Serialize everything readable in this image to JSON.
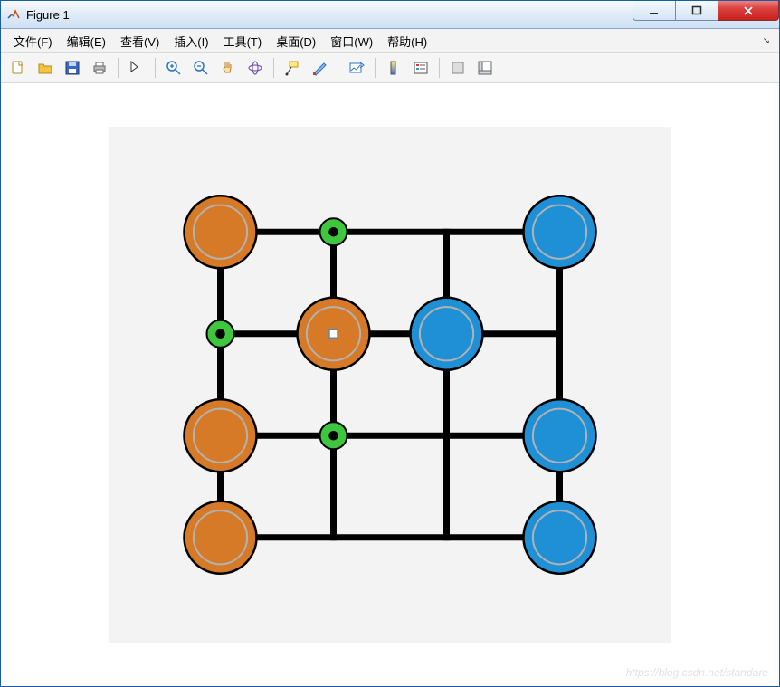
{
  "window": {
    "title": "Figure 1"
  },
  "menus": {
    "file": "文件(F)",
    "edit": "编辑(E)",
    "view": "查看(V)",
    "insert": "插入(I)",
    "tools": "工具(T)",
    "desktop": "桌面(D)",
    "window": "窗口(W)",
    "help": "帮助(H)"
  },
  "watermark": "https://blog.csdn.net/standare",
  "colors": {
    "orange": "#d67a28",
    "blue": "#1f8fd6",
    "green": "#3fc63f",
    "ring": "#b2b2b2",
    "edge": "#000000",
    "axes_bg": "#f3f3f3"
  },
  "chart_data": {
    "type": "network",
    "title": "",
    "xlim": [
      0.5,
      4.5
    ],
    "ylim": [
      0.5,
      4.5
    ],
    "grid_vertices": [
      {
        "x": 1,
        "y": 4
      },
      {
        "x": 2,
        "y": 4
      },
      {
        "x": 3,
        "y": 4
      },
      {
        "x": 4,
        "y": 4
      },
      {
        "x": 1,
        "y": 3
      },
      {
        "x": 2,
        "y": 3
      },
      {
        "x": 3,
        "y": 3
      },
      {
        "x": 4,
        "y": 3
      },
      {
        "x": 1,
        "y": 2
      },
      {
        "x": 2,
        "y": 2
      },
      {
        "x": 3,
        "y": 2
      },
      {
        "x": 4,
        "y": 2
      },
      {
        "x": 1,
        "y": 1
      },
      {
        "x": 2,
        "y": 1
      },
      {
        "x": 3,
        "y": 1
      },
      {
        "x": 4,
        "y": 1
      }
    ],
    "grid_edges": [
      [
        [
          1,
          4
        ],
        [
          4,
          4
        ]
      ],
      [
        [
          1,
          3
        ],
        [
          4,
          3
        ]
      ],
      [
        [
          1,
          2
        ],
        [
          4,
          2
        ]
      ],
      [
        [
          1,
          1
        ],
        [
          4,
          1
        ]
      ],
      [
        [
          1,
          1
        ],
        [
          1,
          4
        ]
      ],
      [
        [
          2,
          1
        ],
        [
          2,
          4
        ]
      ],
      [
        [
          3,
          1
        ],
        [
          3,
          4
        ]
      ],
      [
        [
          4,
          1
        ],
        [
          4,
          4
        ]
      ]
    ],
    "big_nodes": [
      {
        "x": 1,
        "y": 4,
        "color": "orange"
      },
      {
        "x": 4,
        "y": 4,
        "color": "blue"
      },
      {
        "x": 2,
        "y": 3,
        "color": "orange",
        "marker": "square"
      },
      {
        "x": 3,
        "y": 3,
        "color": "blue"
      },
      {
        "x": 1,
        "y": 2,
        "color": "orange"
      },
      {
        "x": 4,
        "y": 2,
        "color": "blue"
      },
      {
        "x": 1,
        "y": 1,
        "color": "orange"
      },
      {
        "x": 4,
        "y": 1,
        "color": "blue"
      }
    ],
    "small_nodes": [
      {
        "x": 2,
        "y": 4,
        "color": "green",
        "dot": true
      },
      {
        "x": 1,
        "y": 3,
        "color": "green",
        "dot": true
      },
      {
        "x": 2,
        "y": 2,
        "color": "green",
        "dot": true
      }
    ],
    "big_radius": 0.32,
    "small_radius": 0.12
  }
}
